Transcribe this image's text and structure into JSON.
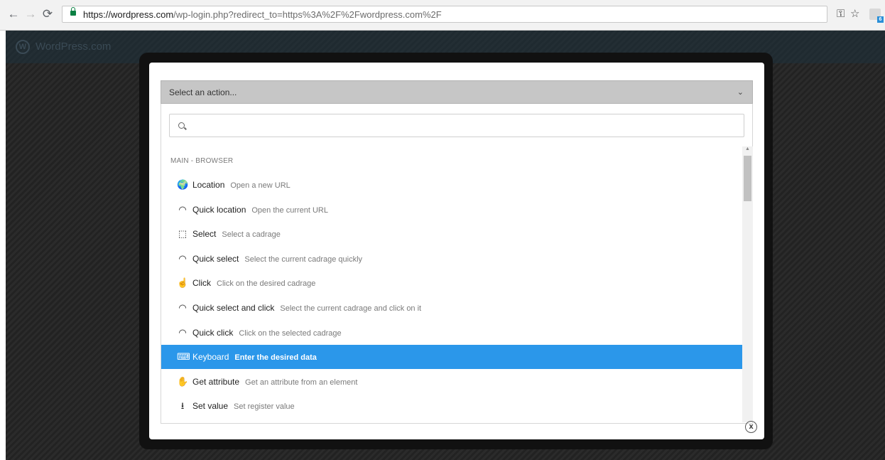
{
  "browser": {
    "url_host": "https://wordpress.com",
    "url_rest": "/wp-login.php?redirect_to=https%3A%2F%2Fwordpress.com%2F",
    "back_icon": "back-arrow-icon",
    "forward_icon": "forward-arrow-icon",
    "reload_icon": "reload-icon",
    "ext_badge": "6"
  },
  "site": {
    "name": "WordPress.com"
  },
  "modal": {
    "select_placeholder": "Select an action...",
    "search_placeholder": "",
    "group_label": "MAIN - BROWSER",
    "items": [
      {
        "label": "Location",
        "desc": "Open a new URL",
        "icon": "globe-icon",
        "glyph": "🌍"
      },
      {
        "label": "Quick location",
        "desc": "Open the current URL",
        "icon": "speedometer-icon",
        "glyph": "◠"
      },
      {
        "label": "Select",
        "desc": "Select a cadrage",
        "icon": "select-cursor-icon",
        "glyph": "⬚"
      },
      {
        "label": "Quick select",
        "desc": "Select the current cadrage quickly",
        "icon": "speedometer-icon",
        "glyph": "◠"
      },
      {
        "label": "Click",
        "desc": "Click on the desired cadrage",
        "icon": "click-hand-icon",
        "glyph": "☝"
      },
      {
        "label": "Quick select and click",
        "desc": "Select the current cadrage and click on it",
        "icon": "speedometer-icon",
        "glyph": "◠"
      },
      {
        "label": "Quick click",
        "desc": "Click on the selected cadrage",
        "icon": "speedometer-icon",
        "glyph": "◠"
      },
      {
        "label": "Keyboard",
        "desc": "Enter the desired data",
        "icon": "keyboard-icon",
        "glyph": "⌨",
        "active": true
      },
      {
        "label": "Get attribute",
        "desc": "Get an attribute from an element",
        "icon": "hand-grab-icon",
        "glyph": "✋"
      },
      {
        "label": "Set value",
        "desc": "Set register value",
        "icon": "download-icon",
        "glyph": "⭳"
      }
    ],
    "close_label": "x"
  }
}
